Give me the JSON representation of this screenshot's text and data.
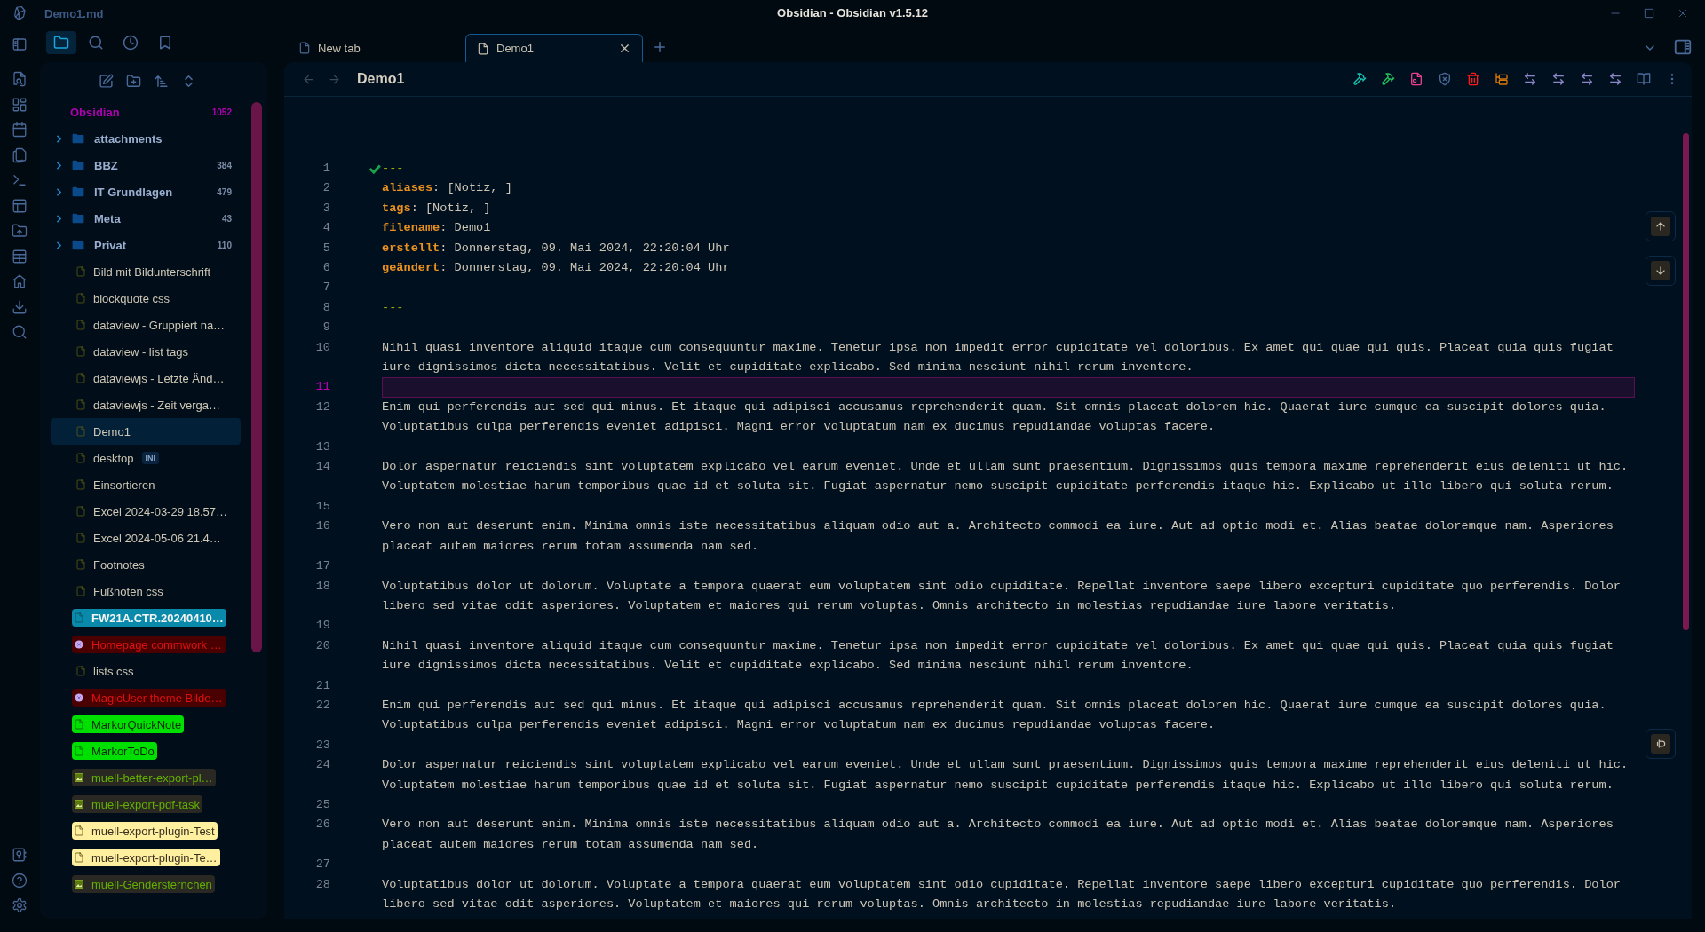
{
  "window": {
    "file": "Demo1.md",
    "title": "Obsidian - Obsidian v1.5.12"
  },
  "sidebar": {
    "tabs": [
      {
        "selected": true
      },
      {
        "selected": false
      },
      {
        "selected": false
      },
      {
        "selected": false
      }
    ],
    "root": {
      "label": "Obsidian",
      "count": "1052"
    },
    "items": [
      {
        "kind": "folder",
        "label": "attachments",
        "expanded": false
      },
      {
        "kind": "folder",
        "label": "BBZ",
        "count": "384",
        "expanded": false
      },
      {
        "kind": "folder",
        "label": "IT Grundlagen",
        "count": "479",
        "expanded": false
      },
      {
        "kind": "folder",
        "label": "Meta",
        "count": "43",
        "expanded": false
      },
      {
        "kind": "folder",
        "label": "Privat",
        "count": "110",
        "expanded": false
      },
      {
        "kind": "file",
        "label": "Bild mit Bildunterschrift",
        "selected": false
      },
      {
        "kind": "file",
        "label": "blockquote css",
        "selected": false
      },
      {
        "kind": "file",
        "label": "dataview - Gruppiert na…",
        "selected": false
      },
      {
        "kind": "file",
        "label": "dataview - list tags",
        "selected": false
      },
      {
        "kind": "file",
        "label": "dataviewjs - Letzte Änd…",
        "selected": false
      },
      {
        "kind": "file",
        "label": "dataviewjs - Zeit verga…",
        "selected": false
      },
      {
        "kind": "file",
        "label": "Demo1",
        "selected": true
      },
      {
        "kind": "file",
        "label": "desktop",
        "badge": "INI",
        "selected": false
      },
      {
        "kind": "file",
        "label": "Einsortieren",
        "selected": false
      },
      {
        "kind": "file",
        "label": "Excel 2024-03-29 18.57…",
        "selected": false
      },
      {
        "kind": "file",
        "label": "Excel 2024-05-06 21.4…",
        "selected": false
      },
      {
        "kind": "file",
        "label": "Footnotes",
        "selected": false
      },
      {
        "kind": "file",
        "label": "Fußnoten css",
        "selected": false
      },
      {
        "kind": "file",
        "label": "FW21A.CTR.20240410…",
        "color": "#0a8aaa",
        "selected": false
      },
      {
        "kind": "circle",
        "label": "Homepage commwork …",
        "color": "#4a0000",
        "selected": false
      },
      {
        "kind": "file",
        "label": "lists css",
        "selected": false
      },
      {
        "kind": "circle",
        "label": "MagicUser theme Bilde…",
        "color": "#4a0000",
        "selected": false
      },
      {
        "kind": "file",
        "label": "MarkorQuickNote",
        "color": "#00e000",
        "selected": false
      },
      {
        "kind": "file",
        "label": "MarkorToDo",
        "color": "#00e000",
        "selected": false
      },
      {
        "kind": "image",
        "label": "muell-better-export-pl…",
        "color": "#2a2822",
        "selected": false
      },
      {
        "kind": "image",
        "label": "muell-export-pdf-task",
        "color": "#2a2822",
        "selected": false
      },
      {
        "kind": "file",
        "label": "muell-export-plugin-Test",
        "color": "#fff0a0",
        "selected": false
      },
      {
        "kind": "file",
        "label": "muell-export-plugin-Te…",
        "color": "#fff0a0",
        "selected": false
      },
      {
        "kind": "image",
        "label": "muell-Gendersternchen",
        "color": "#2a2822",
        "selected": false
      }
    ]
  },
  "tabs": [
    {
      "label": "New tab",
      "selected": false
    },
    {
      "label": "Demo1",
      "selected": true
    }
  ],
  "note": {
    "title": "Demo1",
    "lines": [
      {
        "number": "1",
        "kind": "marker",
        "text": "---",
        "valid": true
      },
      {
        "number": "2",
        "kind": "property",
        "key": "aliases",
        "rest": ": [Notiz, ]"
      },
      {
        "number": "3",
        "kind": "property",
        "key": "tags",
        "rest": ": [Notiz, ]"
      },
      {
        "number": "4",
        "kind": "property",
        "key": "filename",
        "rest": ": Demo1"
      },
      {
        "number": "5",
        "kind": "property",
        "key": "erstellt",
        "rest": ": Donnerstag, 09. Mai 2024, 22:20:04 Uhr"
      },
      {
        "number": "6",
        "kind": "property",
        "key": "geändert",
        "rest": ": Donnerstag, 09. Mai 2024, 22:20:04 Uhr"
      },
      {
        "number": "7",
        "kind": "empty",
        "active": false
      },
      {
        "number": "8",
        "kind": "marker",
        "text": "---"
      },
      {
        "number": "9",
        "kind": "empty",
        "active": false
      },
      {
        "number": "10",
        "kind": "paragraph",
        "text": "Nihil quasi inventore aliquid itaque cum consequuntur maxime. Tenetur ipsa non impedit error cupiditate vel doloribus. Ex amet qui quae qui quis. Placeat quia quis fugiat iure dignissimos dicta necessitatibus. Velit et cupiditate explicabo. Sed minima nesciunt nihil rerum inventore."
      },
      {
        "number": "11",
        "kind": "empty",
        "active": true
      },
      {
        "number": "12",
        "kind": "paragraph",
        "text": "Enim qui perferendis aut sed qui minus. Et itaque qui adipisci accusamus reprehenderit quam. Sit omnis placeat dolorem hic. Quaerat iure cumque ea suscipit dolores quia. Voluptatibus culpa perferendis eveniet adipisci. Magni error voluptatum nam ex ducimus repudiandae voluptas facere."
      },
      {
        "number": "13",
        "kind": "empty",
        "active": false
      },
      {
        "number": "14",
        "kind": "paragraph",
        "text": "Dolor aspernatur reiciendis sint voluptatem explicabo vel earum eveniet. Unde et ullam sunt praesentium. Dignissimos quis tempora maxime reprehenderit eius deleniti ut hic. Voluptatem molestiae harum temporibus quae id et soluta sit. Fugiat aspernatur nemo suscipit cupiditate perferendis itaque hic. Explicabo ut illo libero qui soluta rerum."
      },
      {
        "number": "15",
        "kind": "empty",
        "active": false
      },
      {
        "number": "16",
        "kind": "paragraph",
        "text": "Vero non aut deserunt enim. Minima omnis iste necessitatibus aliquam odio aut a. Architecto commodi ea iure. Aut ad optio modi et. Alias beatae doloremque nam. Asperiores placeat autem maiores rerum totam assumenda nam sed."
      },
      {
        "number": "17",
        "kind": "empty",
        "active": false
      },
      {
        "number": "18",
        "kind": "paragraph",
        "text": "Voluptatibus dolor ut dolorum. Voluptate a tempora quaerat eum voluptatem sint odio cupiditate. Repellat inventore saepe libero excepturi cupiditate quo perferendis. Dolor libero sed vitae odit asperiores. Voluptatem et maiores qui rerum voluptas. Omnis architecto in molestias repudiandae iure labore veritatis."
      },
      {
        "number": "19",
        "kind": "empty",
        "active": false
      },
      {
        "number": "20",
        "kind": "paragraph",
        "text": "Nihil quasi inventore aliquid itaque cum consequuntur maxime. Tenetur ipsa non impedit error cupiditate vel doloribus. Ex amet qui quae qui quis. Placeat quia quis fugiat iure dignissimos dicta necessitatibus. Velit et cupiditate explicabo. Sed minima nesciunt nihil rerum inventore."
      },
      {
        "number": "21",
        "kind": "empty",
        "active": false
      },
      {
        "number": "22",
        "kind": "paragraph",
        "text": "Enim qui perferendis aut sed qui minus. Et itaque qui adipisci accusamus reprehenderit quam. Sit omnis placeat dolorem hic. Quaerat iure cumque ea suscipit dolores quia. Voluptatibus culpa perferendis eveniet adipisci. Magni error voluptatum nam ex ducimus repudiandae voluptas facere."
      },
      {
        "number": "23",
        "kind": "empty",
        "active": false
      },
      {
        "number": "24",
        "kind": "paragraph",
        "text": "Dolor aspernatur reiciendis sint voluptatem explicabo vel earum eveniet. Unde et ullam sunt praesentium. Dignissimos quis tempora maxime reprehenderit eius deleniti ut hic. Voluptatem molestiae harum temporibus quae id et soluta sit. Fugiat aspernatur nemo suscipit cupiditate perferendis itaque hic. Explicabo ut illo libero qui soluta rerum."
      },
      {
        "number": "25",
        "kind": "empty",
        "active": false
      },
      {
        "number": "26",
        "kind": "paragraph",
        "text": "Vero non aut deserunt enim. Minima omnis iste necessitatibus aliquam odio aut a. Architecto commodi ea iure. Aut ad optio modi et. Alias beatae doloremque nam. Asperiores placeat autem maiores rerum totam assumenda nam sed."
      },
      {
        "number": "27",
        "kind": "empty",
        "active": false
      },
      {
        "number": "28",
        "kind": "paragraph",
        "text": "Voluptatibus dolor ut dolorum. Voluptate a tempora quaerat eum voluptatem sint odio cupiditate. Repellat inventore saepe libero excepturi cupiditate quo perferendis. Dolor libero sed vitae odit asperiores. Voluptatem et maiores qui rerum voluptas. Omnis architecto in molestias repudiandae iure labore veritatis."
      }
    ]
  }
}
